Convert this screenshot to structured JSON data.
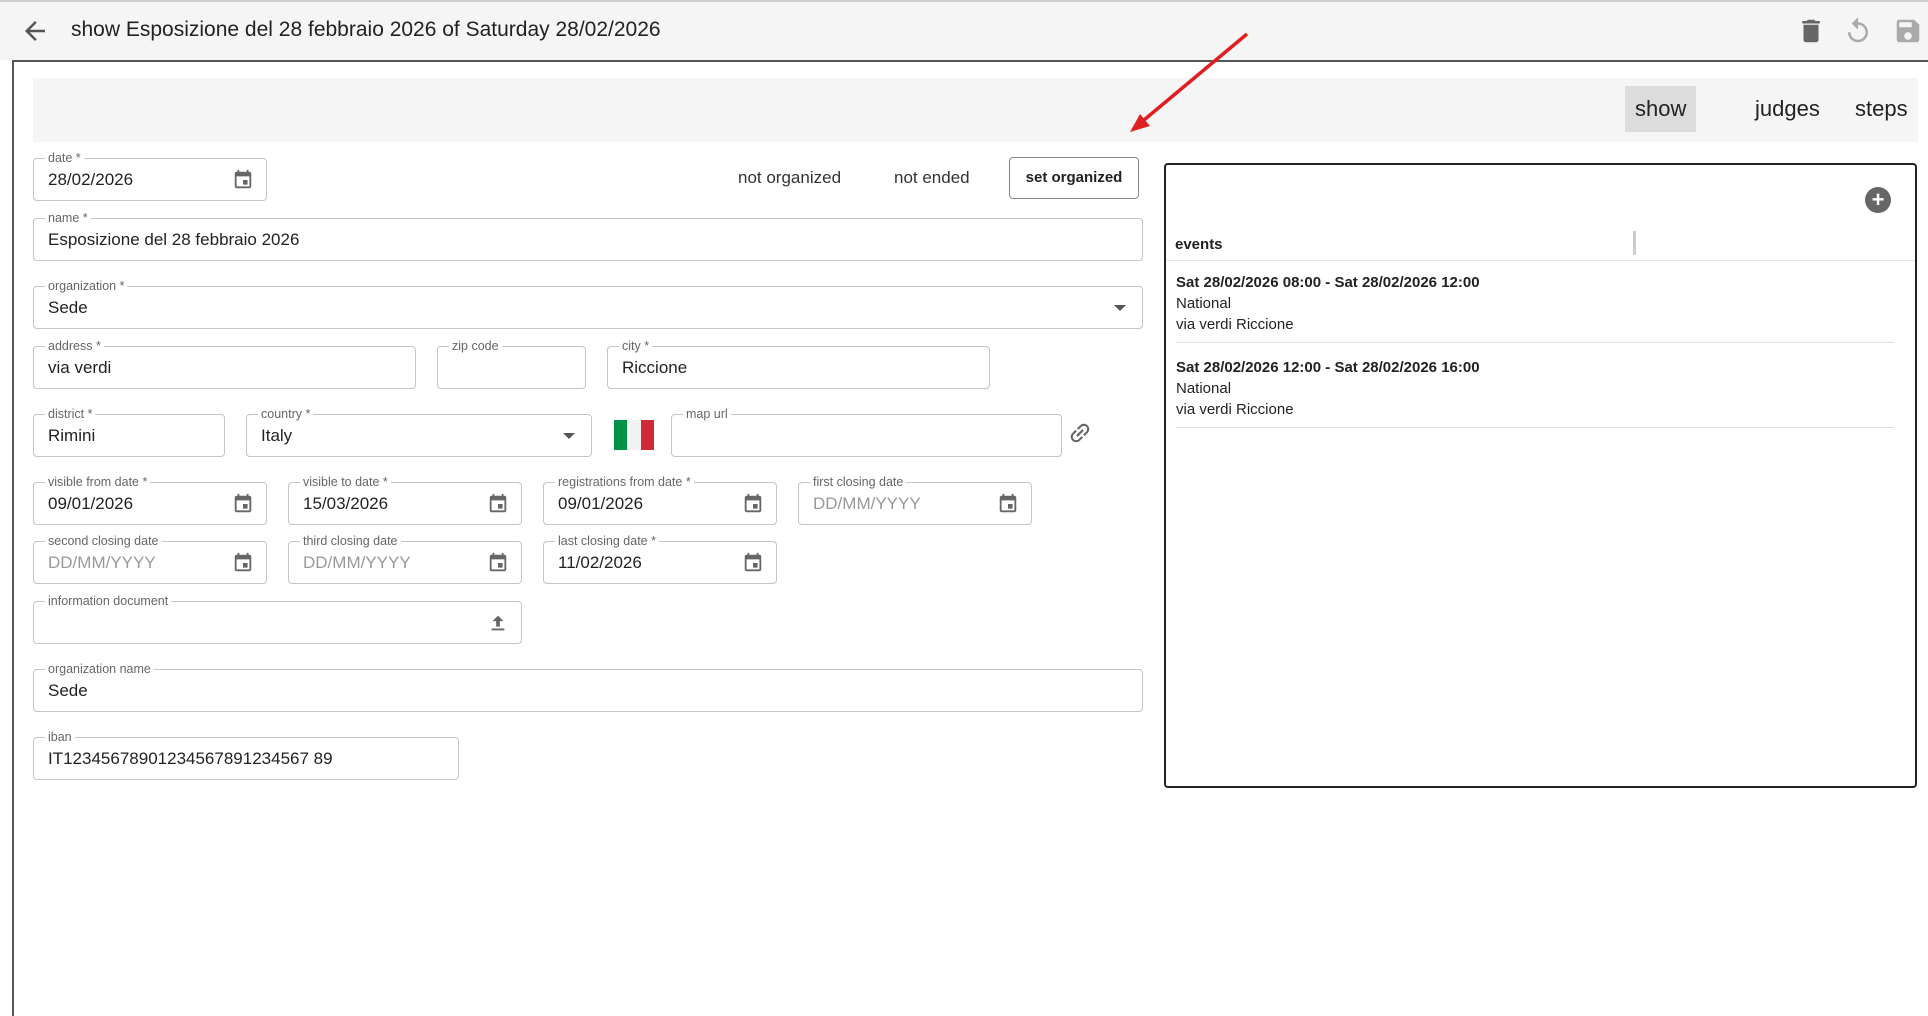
{
  "header": {
    "title": "show Esposizione del 28 febbraio 2026 of Saturday 28/02/2026",
    "icons": [
      "back-arrow-icon",
      "trash-icon",
      "undo-icon",
      "save-icon"
    ]
  },
  "tabs": [
    {
      "label": "show",
      "active": true
    },
    {
      "label": "judges",
      "active": false
    },
    {
      "label": "steps",
      "active": false
    }
  ],
  "status": {
    "organized": "not organized",
    "ended": "not ended",
    "set_organized_label": "set organized"
  },
  "form": {
    "date": {
      "label": "date *",
      "value": "28/02/2026"
    },
    "name": {
      "label": "name *",
      "value": "Esposizione del 28 febbraio 2026"
    },
    "organization": {
      "label": "organization *",
      "value": "Sede"
    },
    "address": {
      "label": "address *",
      "value": "via verdi"
    },
    "zip": {
      "label": "zip code",
      "value": ""
    },
    "city": {
      "label": "city *",
      "value": "Riccione"
    },
    "district": {
      "label": "district *",
      "value": "Rimini"
    },
    "country": {
      "label": "country *",
      "value": "Italy",
      "flag_colors": [
        "#009246",
        "#ffffff",
        "#ce2b37"
      ]
    },
    "map_url": {
      "label": "map url",
      "value": ""
    },
    "visible_from": {
      "label": "visible from date *",
      "value": "09/01/2026"
    },
    "visible_to": {
      "label": "visible to date *",
      "value": "15/03/2026"
    },
    "registrations_from": {
      "label": "registrations from date *",
      "value": "09/01/2026"
    },
    "first_closing": {
      "label": "first closing date",
      "placeholder": "DD/MM/YYYY"
    },
    "second_closing": {
      "label": "second closing date",
      "placeholder": "DD/MM/YYYY"
    },
    "third_closing": {
      "label": "third closing date",
      "placeholder": "DD/MM/YYYY"
    },
    "last_closing": {
      "label": "last closing date *",
      "value": "11/02/2026"
    },
    "information_document": {
      "label": "information document",
      "value": ""
    },
    "organization_name": {
      "label": "organization name",
      "value": "Sede"
    },
    "iban": {
      "label": "iban",
      "value": "IT12345678901234567891234567 89"
    }
  },
  "events_panel": {
    "header": "events",
    "items": [
      {
        "time": "Sat 28/02/2026 08:00 - Sat 28/02/2026 12:00",
        "type": "National",
        "place": "via verdi Riccione"
      },
      {
        "time": "Sat 28/02/2026 12:00 - Sat 28/02/2026 16:00",
        "type": "National",
        "place": "via verdi Riccione"
      }
    ]
  },
  "colors": {
    "accent_arrow": "#e02020"
  }
}
